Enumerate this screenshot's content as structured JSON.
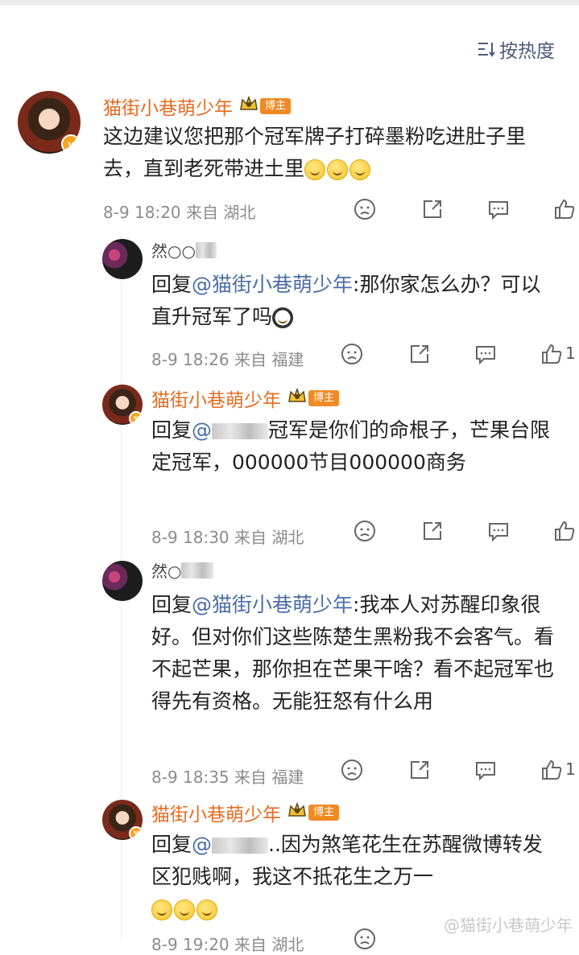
{
  "sort": {
    "label": "按热度",
    "icon": "sort-icon"
  },
  "main_comment": {
    "author": "猫街小巷萌少年",
    "badge": "博主",
    "text": "这边建议您把那个冠军牌子打碎墨粉吃进肚子里去，直到老死带进土里",
    "time": "8-9 18:20",
    "location_prefix": "来自",
    "location": "湖北"
  },
  "replies": [
    {
      "author_partial": "然○○",
      "reply_prefix": "回复",
      "mention": "@猫街小巷萌少年",
      "text": ":那你家怎么办？可以直升冠军了吗",
      "time": "8-9 18:26",
      "location_prefix": "来自",
      "location": "福建",
      "likes": "1"
    },
    {
      "author": "猫街小巷萌少年",
      "badge": "博主",
      "reply_prefix": "回复",
      "mention_partial": "@",
      "text": "冠军是你们的命根子，芒果台限定冠军，000000节目000000商务",
      "time": "8-9 18:30",
      "location_prefix": "来自",
      "location": "湖北",
      "likes": ""
    },
    {
      "author_partial": "然○",
      "reply_prefix": "回复",
      "mention": "@猫街小巷萌少年",
      "text": ":我本人对苏醒印象很好。但对你们这些陈楚生黑粉我不会客气。看不起芒果，那你担在芒果干啥？看不起冠军也得先有资格。无能狂怒有什么用",
      "time": "8-9 18:35",
      "location_prefix": "来自",
      "location": "福建",
      "likes": "1"
    },
    {
      "author": "猫街小巷萌少年",
      "badge": "博主",
      "reply_prefix": "回复",
      "mention_partial": "@",
      "text": "..因为煞笔花生在苏醒微博转发区犯贱啊，我这不抵花生之万一",
      "time": "8-9 19:20",
      "location_prefix": "来自",
      "location": "湖北"
    }
  ],
  "watermark": "@猫街小巷萌少年",
  "colors": {
    "author": "#e86b1f",
    "mention": "#4a6ea8",
    "meta": "#8c8c8c",
    "badge": "#f08a24"
  }
}
